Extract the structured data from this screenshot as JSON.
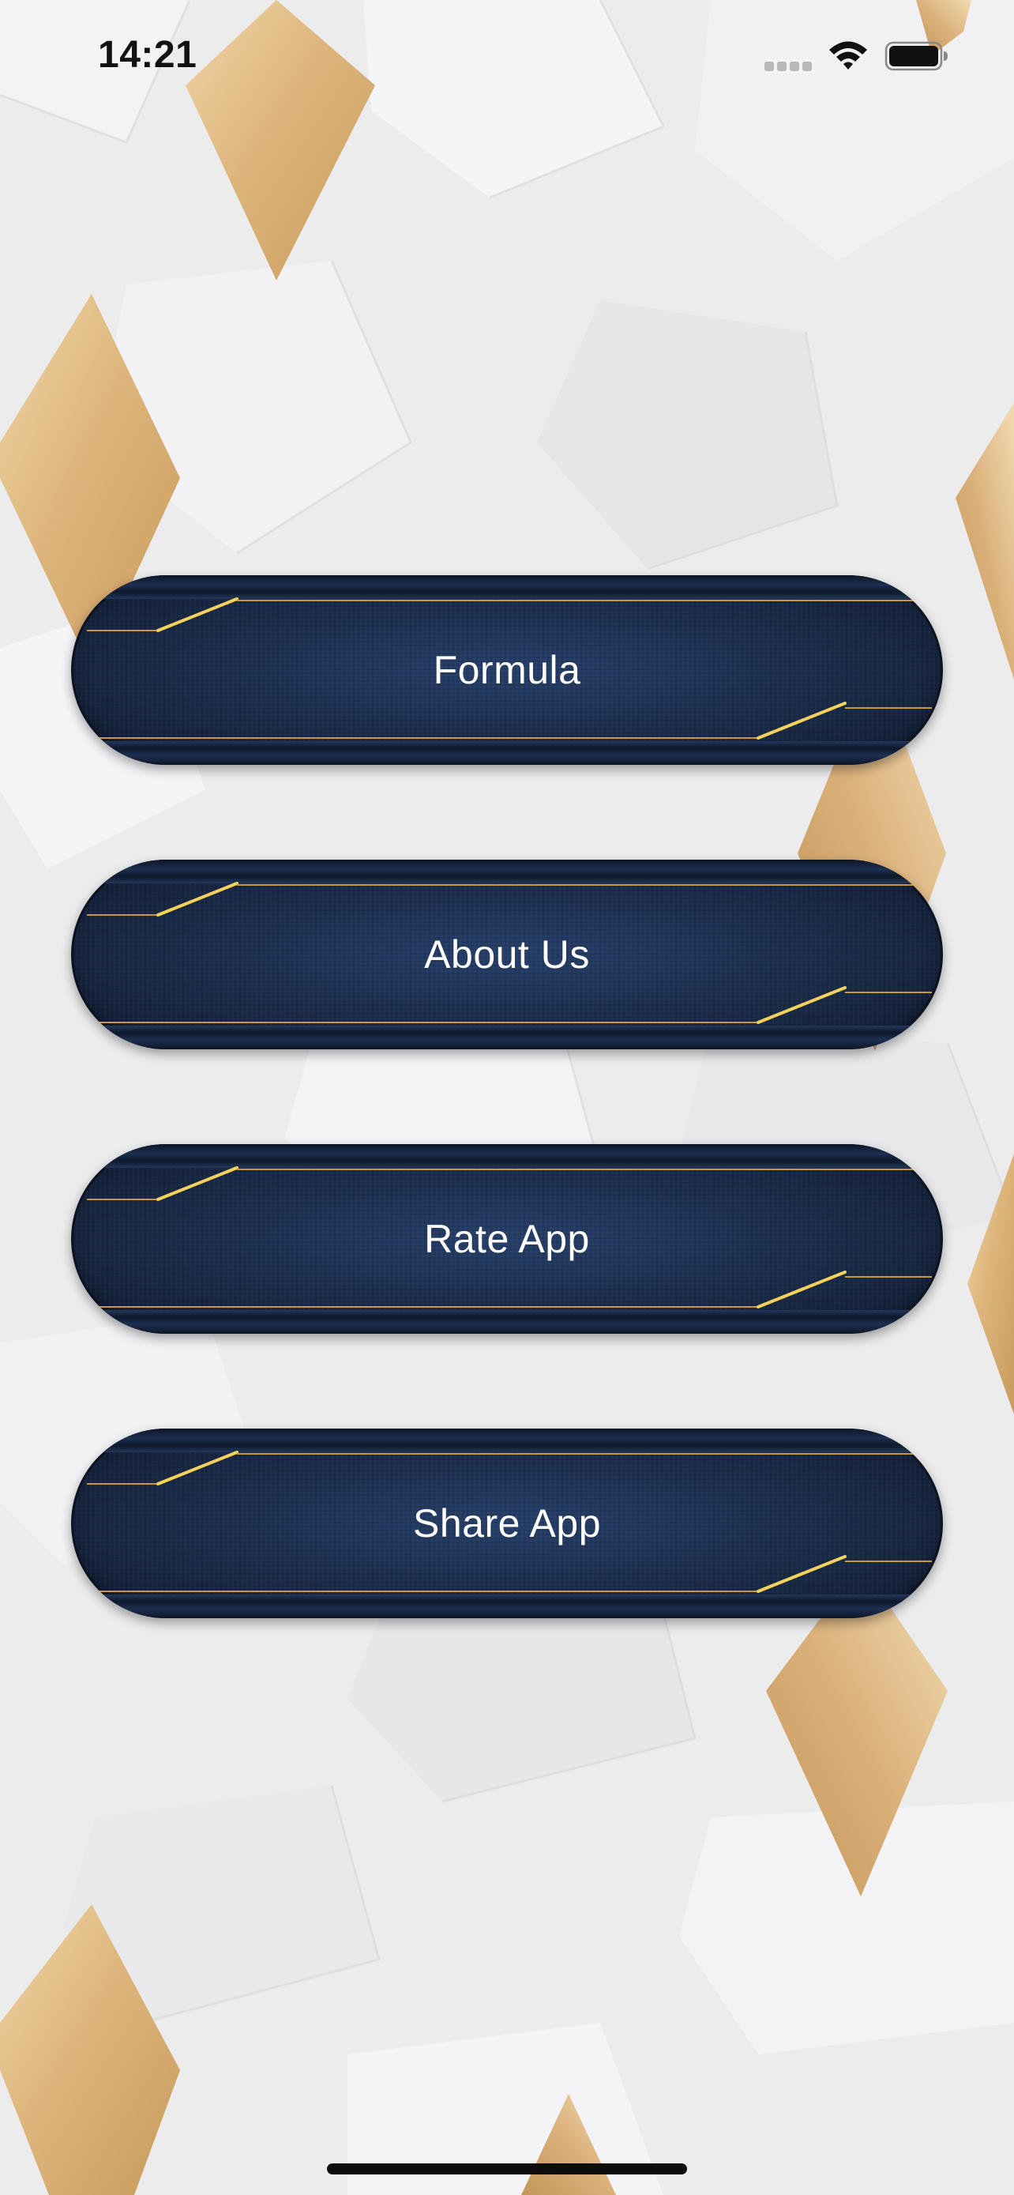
{
  "status_bar": {
    "time": "14:21",
    "icons": [
      "signal-icon",
      "wifi-icon",
      "battery-icon"
    ]
  },
  "menu": {
    "items": [
      {
        "label": "Formula"
      },
      {
        "label": "About Us"
      },
      {
        "label": "Rate App"
      },
      {
        "label": "Share App"
      }
    ]
  },
  "colors": {
    "background": "#ebebec",
    "diamond_gold": "#dcb47e",
    "button_navy": "#1c2f50",
    "button_gold_line": "#c99a2e",
    "button_text": "#ffffff"
  }
}
